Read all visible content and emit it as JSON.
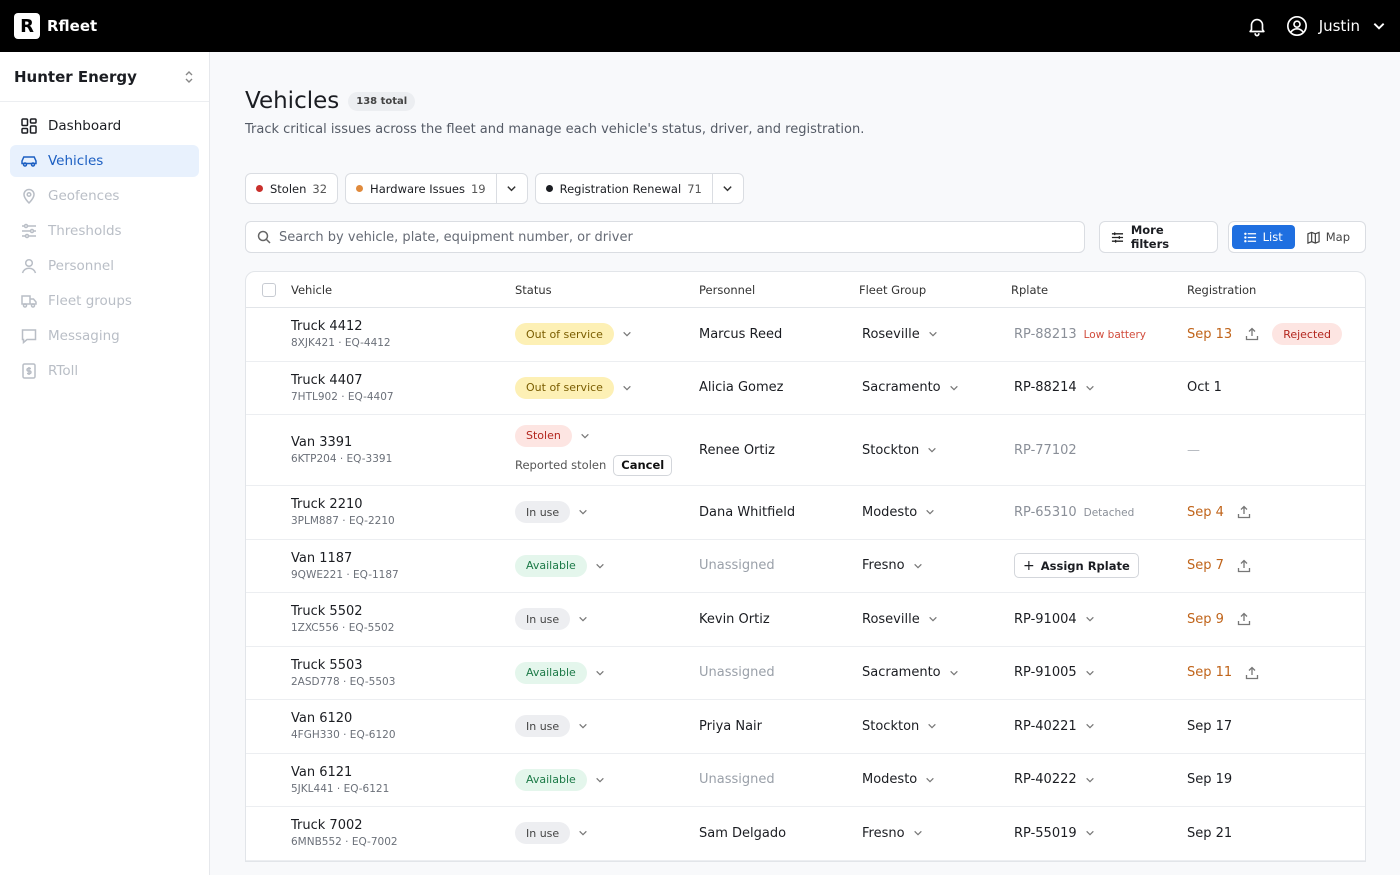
{
  "app": {
    "logo_letter": "R",
    "name": "Rfleet",
    "user": "Justin"
  },
  "org": {
    "name": "Hunter Energy"
  },
  "nav": [
    {
      "label": "Dashboard",
      "icon": "dashboard-icon",
      "state": "normal"
    },
    {
      "label": "Vehicles",
      "icon": "car-icon",
      "state": "active"
    },
    {
      "label": "Geofences",
      "icon": "pin-icon",
      "state": "disabled"
    },
    {
      "label": "Thresholds",
      "icon": "sliders-icon",
      "state": "disabled"
    },
    {
      "label": "Personnel",
      "icon": "person-icon",
      "state": "disabled"
    },
    {
      "label": "Fleet groups",
      "icon": "truck-icon",
      "state": "disabled"
    },
    {
      "label": "Messaging",
      "icon": "chat-icon",
      "state": "disabled"
    },
    {
      "label": "RToll",
      "icon": "toll-icon",
      "state": "disabled"
    }
  ],
  "page": {
    "title": "Vehicles",
    "total_badge": "138 total",
    "subtitle": "Track critical issues across the fleet and manage each vehicle's status, driver, and registration."
  },
  "chips": [
    {
      "label": "Stolen",
      "count": "32",
      "dot_color": "#c9302c",
      "has_dropdown": false
    },
    {
      "label": "Hardware Issues",
      "count": "19",
      "dot_color": "#e08a3c",
      "has_dropdown": true
    },
    {
      "label": "Registration Renewal",
      "count": "71",
      "dot_color": "#1b1d22",
      "has_dropdown": true
    }
  ],
  "toolbar": {
    "search_placeholder": "Search by vehicle, plate, equipment number, or driver",
    "more_filters": "More filters",
    "view_list": "List",
    "view_map": "Map"
  },
  "table": {
    "headers": {
      "vehicle": "Vehicle",
      "status": "Status",
      "personnel": "Personnel",
      "fleet": "Fleet Group",
      "rplate": "Rplate",
      "registration": "Registration"
    },
    "rows": [
      {
        "name": "Truck 4412",
        "sub": "8XJK421 · EQ-4412",
        "status": "Out of service",
        "status_kind": "out",
        "person": "Marcus Reed",
        "person_muted": false,
        "fleet": "Roseville",
        "rplate": "RP-88213",
        "rplate_kind": "warn",
        "rplate_note": "Low battery",
        "reg": "Sep 13",
        "reg_kind": "warn",
        "upload": true,
        "reg_badge": "Rejected"
      },
      {
        "name": "Truck 4407",
        "sub": "7HTL902 · EQ-4407",
        "status": "Out of service",
        "status_kind": "out",
        "person": "Alicia Gomez",
        "person_muted": false,
        "fleet": "Sacramento",
        "rplate": "RP-88214",
        "rplate_kind": "dropdown",
        "rplate_note": "",
        "reg": "Oct 1",
        "reg_kind": "normal",
        "upload": false,
        "reg_badge": ""
      },
      {
        "name": "Van 3391",
        "sub": "6KTP204 · EQ-3391",
        "status": "Stolen",
        "status_kind": "stolen",
        "stolen_note": "Reported stolen",
        "stolen_action": "Cancel",
        "person": "Renee Ortiz",
        "person_muted": false,
        "fleet": "Stockton",
        "rplate": "RP-77102",
        "rplate_kind": "muted",
        "rplate_note": "",
        "reg": "—",
        "reg_kind": "dash",
        "upload": false,
        "reg_badge": ""
      },
      {
        "name": "Truck 2210",
        "sub": "3PLM887 · EQ-2210",
        "status": "In use",
        "status_kind": "inuse",
        "person": "Dana Whitfield",
        "person_muted": false,
        "fleet": "Modesto",
        "rplate": "RP-65310",
        "rplate_kind": "detached",
        "rplate_note": "Detached",
        "reg": "Sep 4",
        "reg_kind": "warn",
        "upload": true,
        "reg_badge": ""
      },
      {
        "name": "Van 1187",
        "sub": "9QWE221 · EQ-1187",
        "status": "Available",
        "status_kind": "avail",
        "person": "Unassigned",
        "person_muted": true,
        "fleet": "Fresno",
        "rplate": "Assign Rplate",
        "rplate_kind": "assign",
        "rplate_note": "",
        "reg": "Sep 7",
        "reg_kind": "warn",
        "upload": true,
        "reg_badge": ""
      },
      {
        "name": "Truck 5502",
        "sub": "1ZXC556 · EQ-5502",
        "status": "In use",
        "status_kind": "inuse",
        "person": "Kevin Ortiz",
        "person_muted": false,
        "fleet": "Roseville",
        "rplate": "RP-91004",
        "rplate_kind": "dropdown",
        "rplate_note": "",
        "reg": "Sep 9",
        "reg_kind": "warn",
        "upload": true,
        "reg_badge": ""
      },
      {
        "name": "Truck 5503",
        "sub": "2ASD778 · EQ-5503",
        "status": "Available",
        "status_kind": "avail",
        "person": "Unassigned",
        "person_muted": true,
        "fleet": "Sacramento",
        "rplate": "RP-91005",
        "rplate_kind": "dropdown",
        "rplate_note": "",
        "reg": "Sep 11",
        "reg_kind": "warn",
        "upload": true,
        "reg_badge": ""
      },
      {
        "name": "Van 6120",
        "sub": "4FGH330 · EQ-6120",
        "status": "In use",
        "status_kind": "inuse",
        "person": "Priya Nair",
        "person_muted": false,
        "fleet": "Stockton",
        "rplate": "RP-40221",
        "rplate_kind": "dropdown",
        "rplate_note": "",
        "reg": "Sep 17",
        "reg_kind": "normal",
        "upload": false,
        "reg_badge": ""
      },
      {
        "name": "Van 6121",
        "sub": "5JKL441 · EQ-6121",
        "status": "Available",
        "status_kind": "avail",
        "person": "Unassigned",
        "person_muted": true,
        "fleet": "Modesto",
        "rplate": "RP-40222",
        "rplate_kind": "dropdown",
        "rplate_note": "",
        "reg": "Sep 19",
        "reg_kind": "normal",
        "upload": false,
        "reg_badge": ""
      },
      {
        "name": "Truck 7002",
        "sub": "6MNB552 · EQ-7002",
        "status": "In use",
        "status_kind": "inuse",
        "person": "Sam Delgado",
        "person_muted": false,
        "fleet": "Fresno",
        "rplate": "RP-55019",
        "rplate_kind": "dropdown",
        "rplate_note": "",
        "reg": "Sep 21",
        "reg_kind": "normal",
        "upload": false,
        "reg_badge": ""
      }
    ]
  },
  "colors": {
    "accent": "#1f6fe0",
    "topbar": "#000000",
    "warn": "#c0641a",
    "danger": "#b3261e"
  }
}
